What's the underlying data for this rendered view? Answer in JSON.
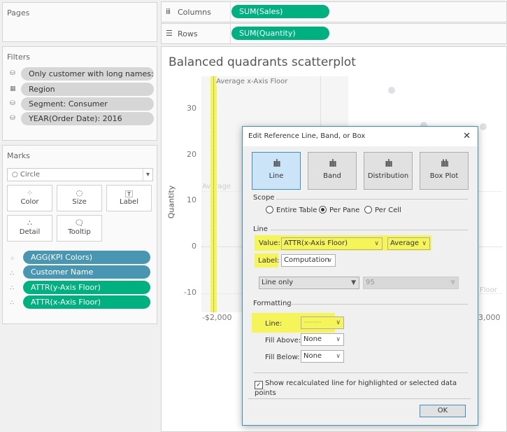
{
  "pages": {
    "title": "Pages"
  },
  "filters": {
    "title": "Filters",
    "items": [
      {
        "label": "Only customer with long names: ..",
        "icon": "database-icon"
      },
      {
        "label": "Region",
        "icon": "hierarchy-filter-icon"
      },
      {
        "label": "Segment: Consumer",
        "icon": "database-icon"
      },
      {
        "label": "YEAR(Order Date): 2016",
        "icon": "database-icon"
      }
    ]
  },
  "marks": {
    "title": "Marks",
    "type": "Circle",
    "buttons": [
      {
        "label": "Color"
      },
      {
        "label": "Size"
      },
      {
        "label": "Label"
      },
      {
        "label": "Detail"
      },
      {
        "label": "Tooltip"
      }
    ],
    "fields": [
      {
        "label": "AGG(KPI Colors)",
        "kind": "color",
        "color": "#4996b2"
      },
      {
        "label": "Customer Name",
        "kind": "detail",
        "color": "#4996b2"
      },
      {
        "label": "ATTR(y-Axis Floor)",
        "kind": "detail",
        "color": "#00b180"
      },
      {
        "label": "ATTR(x-Axis Floor)",
        "kind": "detail",
        "color": "#00b180"
      }
    ]
  },
  "shelves": {
    "columns_label": "Columns",
    "columns_pill": "SUM(Sales)",
    "rows_label": "Rows",
    "rows_pill": "SUM(Quantity)"
  },
  "chart": {
    "title": "Balanced quadrants scatterplot",
    "ylabel": "Quantity",
    "yticks": [
      "30",
      "20",
      "10",
      "0",
      "-10"
    ],
    "xticks": [
      "-$2,000",
      "3,000"
    ],
    "ref_label": "Average x-Axis Floor",
    "faded_label_1": "Average",
    "faded_label_2": "Floor"
  },
  "chart_data": {
    "type": "scatter",
    "ylabel": "Quantity",
    "yticks": [
      30,
      20,
      10,
      0,
      -10
    ],
    "points": [
      {
        "x": 1200,
        "y": 34
      },
      {
        "x": 1790,
        "y": 26.4
      },
      {
        "x": 2870,
        "y": 26.1
      }
    ],
    "reference_line": {
      "axis": "x",
      "label": "Average x-Axis Floor",
      "x": -2000
    }
  },
  "dialog": {
    "title": "Edit Reference Line, Band, or Box",
    "close": "✕",
    "types": [
      {
        "label": "Line",
        "selected": true
      },
      {
        "label": "Band"
      },
      {
        "label": "Distribution"
      },
      {
        "label": "Box Plot"
      }
    ],
    "scope_title": "Scope",
    "scopes": [
      {
        "label": "Entire Table"
      },
      {
        "label": "Per Pane",
        "selected": true
      },
      {
        "label": "Per Cell"
      }
    ],
    "line_title": "Line",
    "value_label": "Value:",
    "value": "ATTR(x-Axis Floor)",
    "aggregation": "Average",
    "label_label": "Label:",
    "label_value": "Computation",
    "ci_mode": "Line only",
    "ci_value": "95",
    "formatting_title": "Formatting",
    "line_label": "Line:",
    "line_style": "··········",
    "fill_above_label": "Fill Above:",
    "fill_above": "None",
    "fill_below_label": "Fill Below:",
    "fill_below": "None",
    "checkbox_label": "Show recalculated line for highlighted or selected data points",
    "checkbox_checked": true,
    "ok": "OK",
    "highlight_color": "#f5f55a"
  }
}
